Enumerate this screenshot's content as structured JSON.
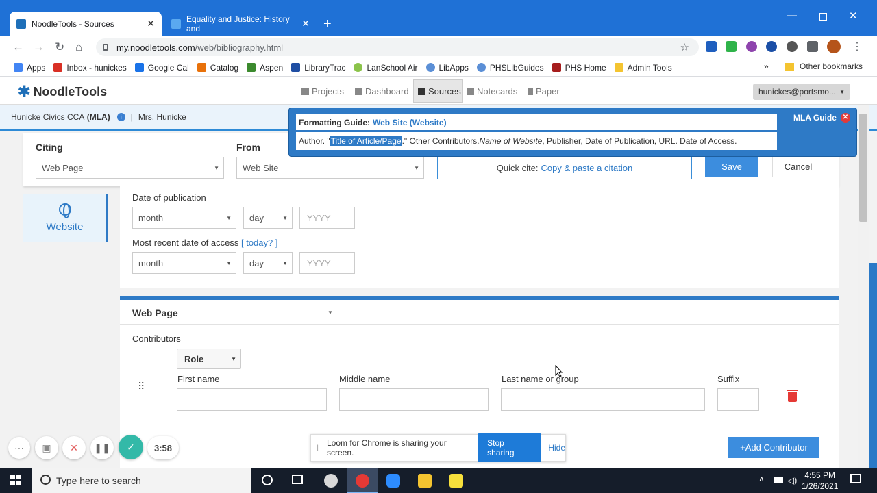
{
  "browser": {
    "tabs": [
      {
        "title": "NoodleTools - Sources",
        "close": "✕"
      },
      {
        "title": "Equality and Justice: History and",
        "close": "✕"
      }
    ],
    "new_tab": "+",
    "url_host": "my.noodletools.com",
    "url_path": "/web/bibliography.html",
    "bookmarks": [
      "Apps",
      "Inbox - hunickes",
      "Google Cal",
      "Catalog",
      "Aspen",
      "LibraryTrac",
      "LanSchool Air",
      "LibApps",
      "PHSLibGuides",
      "PHS Home",
      "Admin Tools"
    ],
    "bookmarks_more": "»",
    "other_bookmarks": "Other bookmarks"
  },
  "app": {
    "logo": "NoodleTools",
    "nav": [
      "Projects",
      "Dashboard",
      "Sources",
      "Notecards",
      "Paper"
    ],
    "user": "hunickes@portsmo...",
    "project_name": "Hunicke Civics CCA",
    "project_style": "(MLA)",
    "project_teacher": "Mrs. Hunicke"
  },
  "cite": {
    "citing_label": "Citing",
    "citing_value": "Web Page",
    "from_label": "From",
    "from_value": "Web Site",
    "quick_cite_prefix": "Quick cite:",
    "quick_cite_link": "Copy & paste a citation",
    "save": "Save",
    "cancel": "Cancel"
  },
  "guide": {
    "label": "Formatting Guide:",
    "type": "Web Site (Website)",
    "pre": "Author. \"",
    "highlight": "Title of Article/Page",
    "mid": ".\" Other Contributors. ",
    "italic": "Name of Website",
    "post": ", Publisher, Date of Publication, URL. Date of Access.",
    "mla_guide": "MLA Guide"
  },
  "sidebar": {
    "website": "Website"
  },
  "dates": {
    "pub_label": "Date of publication",
    "access_label": "Most recent date of access",
    "today_link": "[ today? ]",
    "month": "month",
    "day": "day",
    "year_placeholder": "YYYY"
  },
  "webpage": {
    "title": "Web Page",
    "contributors": "Contributors",
    "role": "Role",
    "first": "First name",
    "middle": "Middle name",
    "last": "Last name or group",
    "suffix": "Suffix",
    "add_contributor": "+Add Contributor"
  },
  "loom": {
    "sharing": "Loom for Chrome is sharing your screen.",
    "stop": "Stop sharing",
    "hide": "Hide",
    "timer": "3:58"
  },
  "taskbar": {
    "search": "Type here to search",
    "time": "4:55 PM",
    "date": "1/26/2021"
  }
}
